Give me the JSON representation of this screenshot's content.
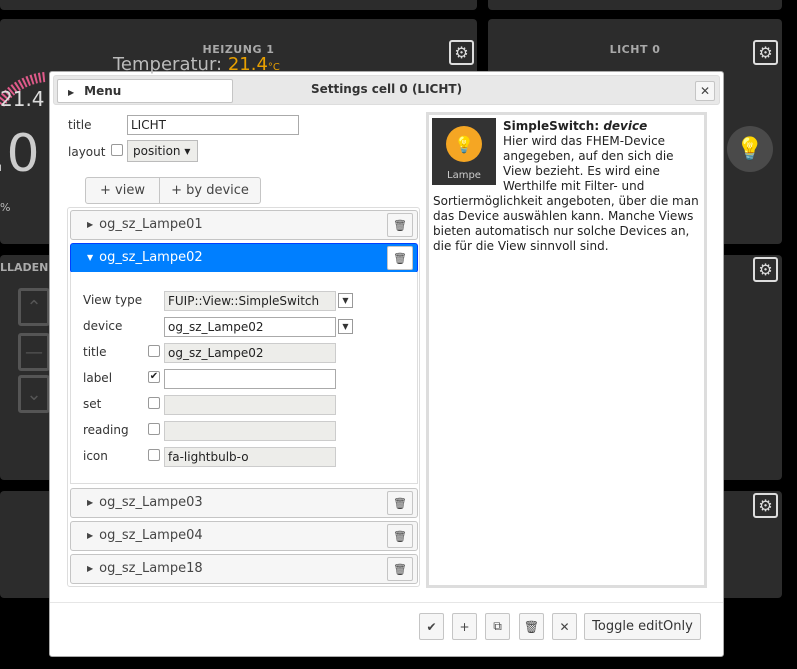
{
  "background": {
    "heizung_title": "HEIZUNG 1",
    "temp_label": "Temperatur:",
    "temp_value": "21.4",
    "temp_unit": "°C",
    "gauge_value": "21.4",
    "big_value": ".0",
    "percent": "%",
    "licht_title": "LICHT 0",
    "rollladen_title": "LLADEN"
  },
  "dialog": {
    "menu_label": "Menu",
    "title": "Settings cell 0 (LICHT)",
    "close_label": "✕",
    "fields": {
      "title_label": "title",
      "title_value": "LICHT",
      "layout_label": "layout",
      "layout_select": "position"
    },
    "add_buttons": {
      "view": "+ view",
      "by_device": "+ by device"
    },
    "views": [
      {
        "name": "og_sz_Lampe01"
      },
      {
        "name": "og_sz_Lampe02"
      },
      {
        "name": "og_sz_Lampe03"
      },
      {
        "name": "og_sz_Lampe04"
      },
      {
        "name": "og_sz_Lampe18"
      }
    ],
    "expanded": {
      "view_type_label": "View type",
      "view_type_value": "FUIP::View::SimpleSwitch",
      "device_label": "device",
      "device_value": "og_sz_Lampe02",
      "title_label": "title",
      "title_value": "og_sz_Lampe02",
      "label_label": "label",
      "label_value": "",
      "set_label": "set",
      "set_value": "",
      "reading_label": "reading",
      "reading_value": "",
      "icon_label": "icon",
      "icon_value": "fa-lightbulb-o"
    },
    "help": {
      "icon_caption": "Lampe",
      "title_prefix": "SimpleSwitch: ",
      "title_field": "device",
      "text": "Hier wird das FHEM-Device angegeben, auf den sich die View bezieht. Es wird eine Werthilfe mit Filter- und Sortiermöglichkeit angeboten, über die man das Device auswählen kann. Manche Views bieten automatisch nur solche Devices an, die für die View sinnvoll sind."
    },
    "footer": {
      "toggle_label": "Toggle editOnly"
    }
  }
}
